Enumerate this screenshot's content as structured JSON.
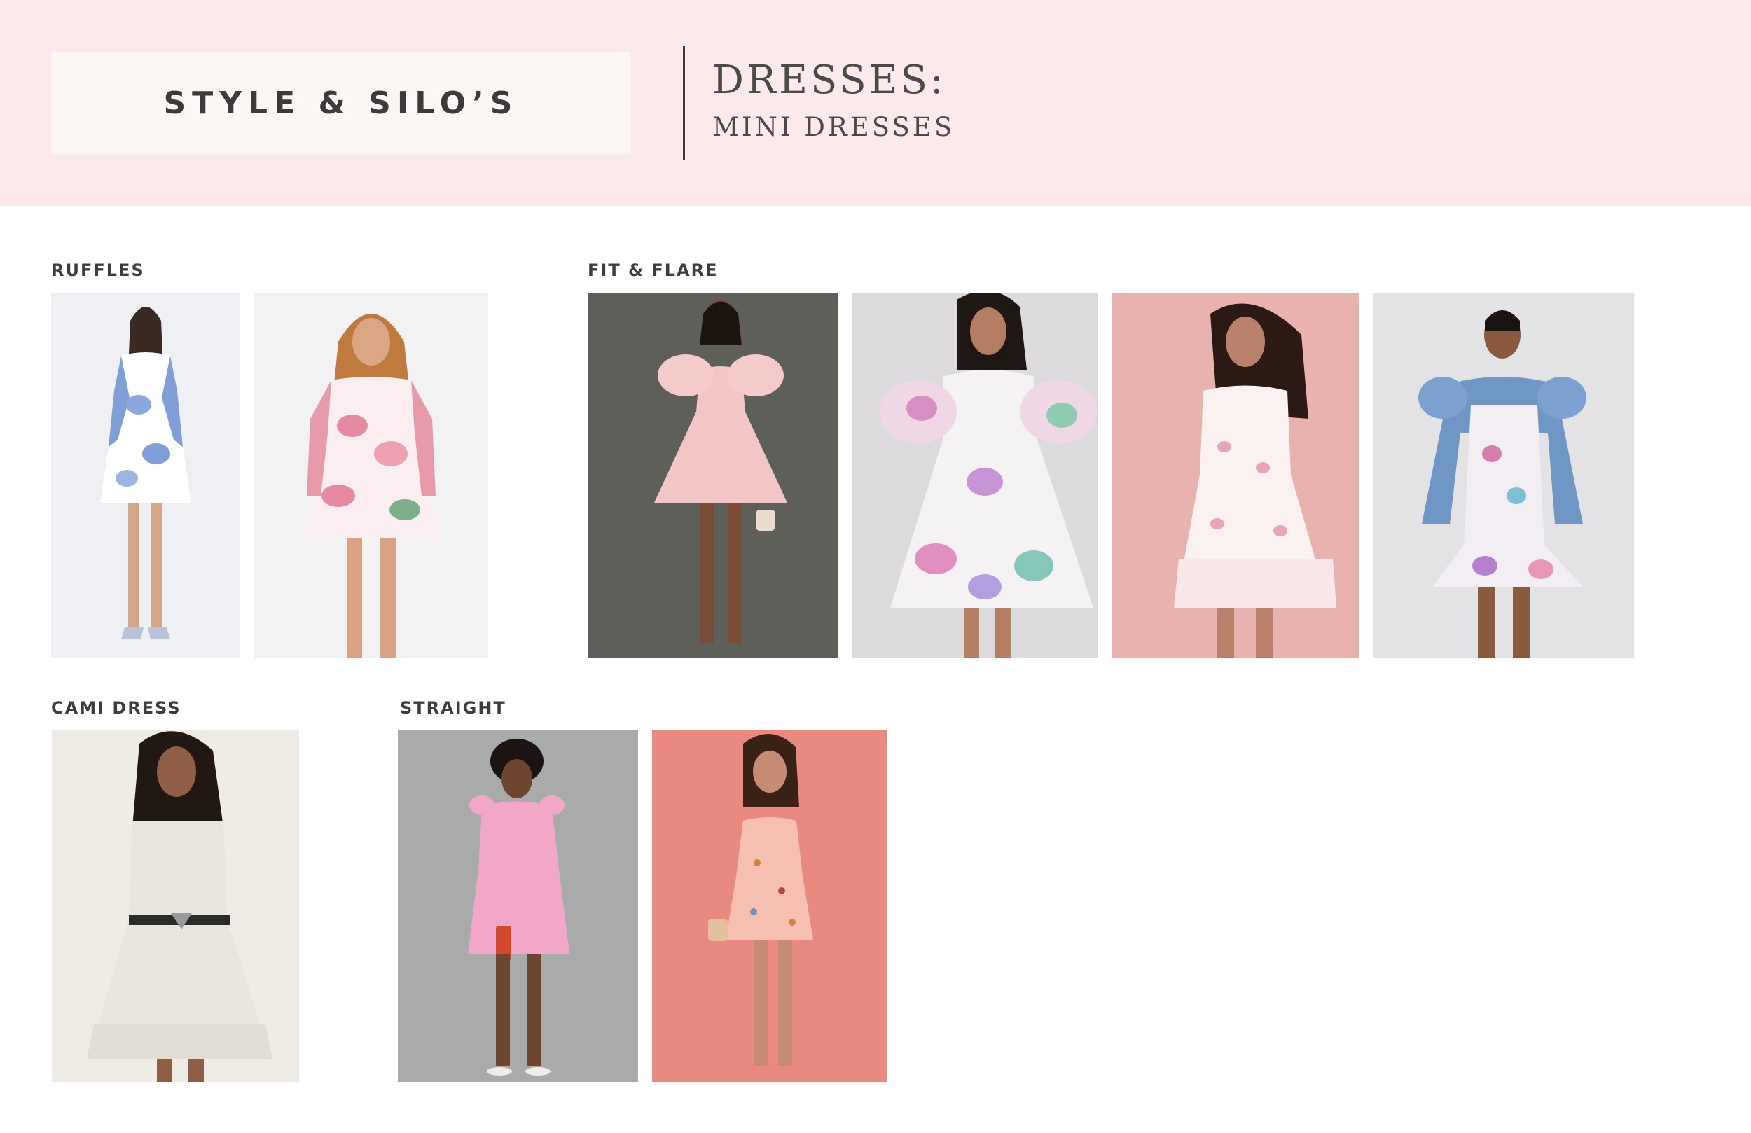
{
  "header": {
    "brand": "STYLE & SILO’S",
    "title": "DRESSES:",
    "subtitle": "MINI DRESSES"
  },
  "sections": {
    "ruffles": {
      "label": "RUFFLES"
    },
    "fit_flare": {
      "label": "FIT & FLARE"
    },
    "cami": {
      "label": "CAMI DRESS"
    },
    "straight": {
      "label": "STRAIGHT"
    }
  },
  "colors": {
    "header_band": "#fce9ea",
    "brand_box": "#fcf6f5",
    "text_dark": "#3b3b3b"
  }
}
